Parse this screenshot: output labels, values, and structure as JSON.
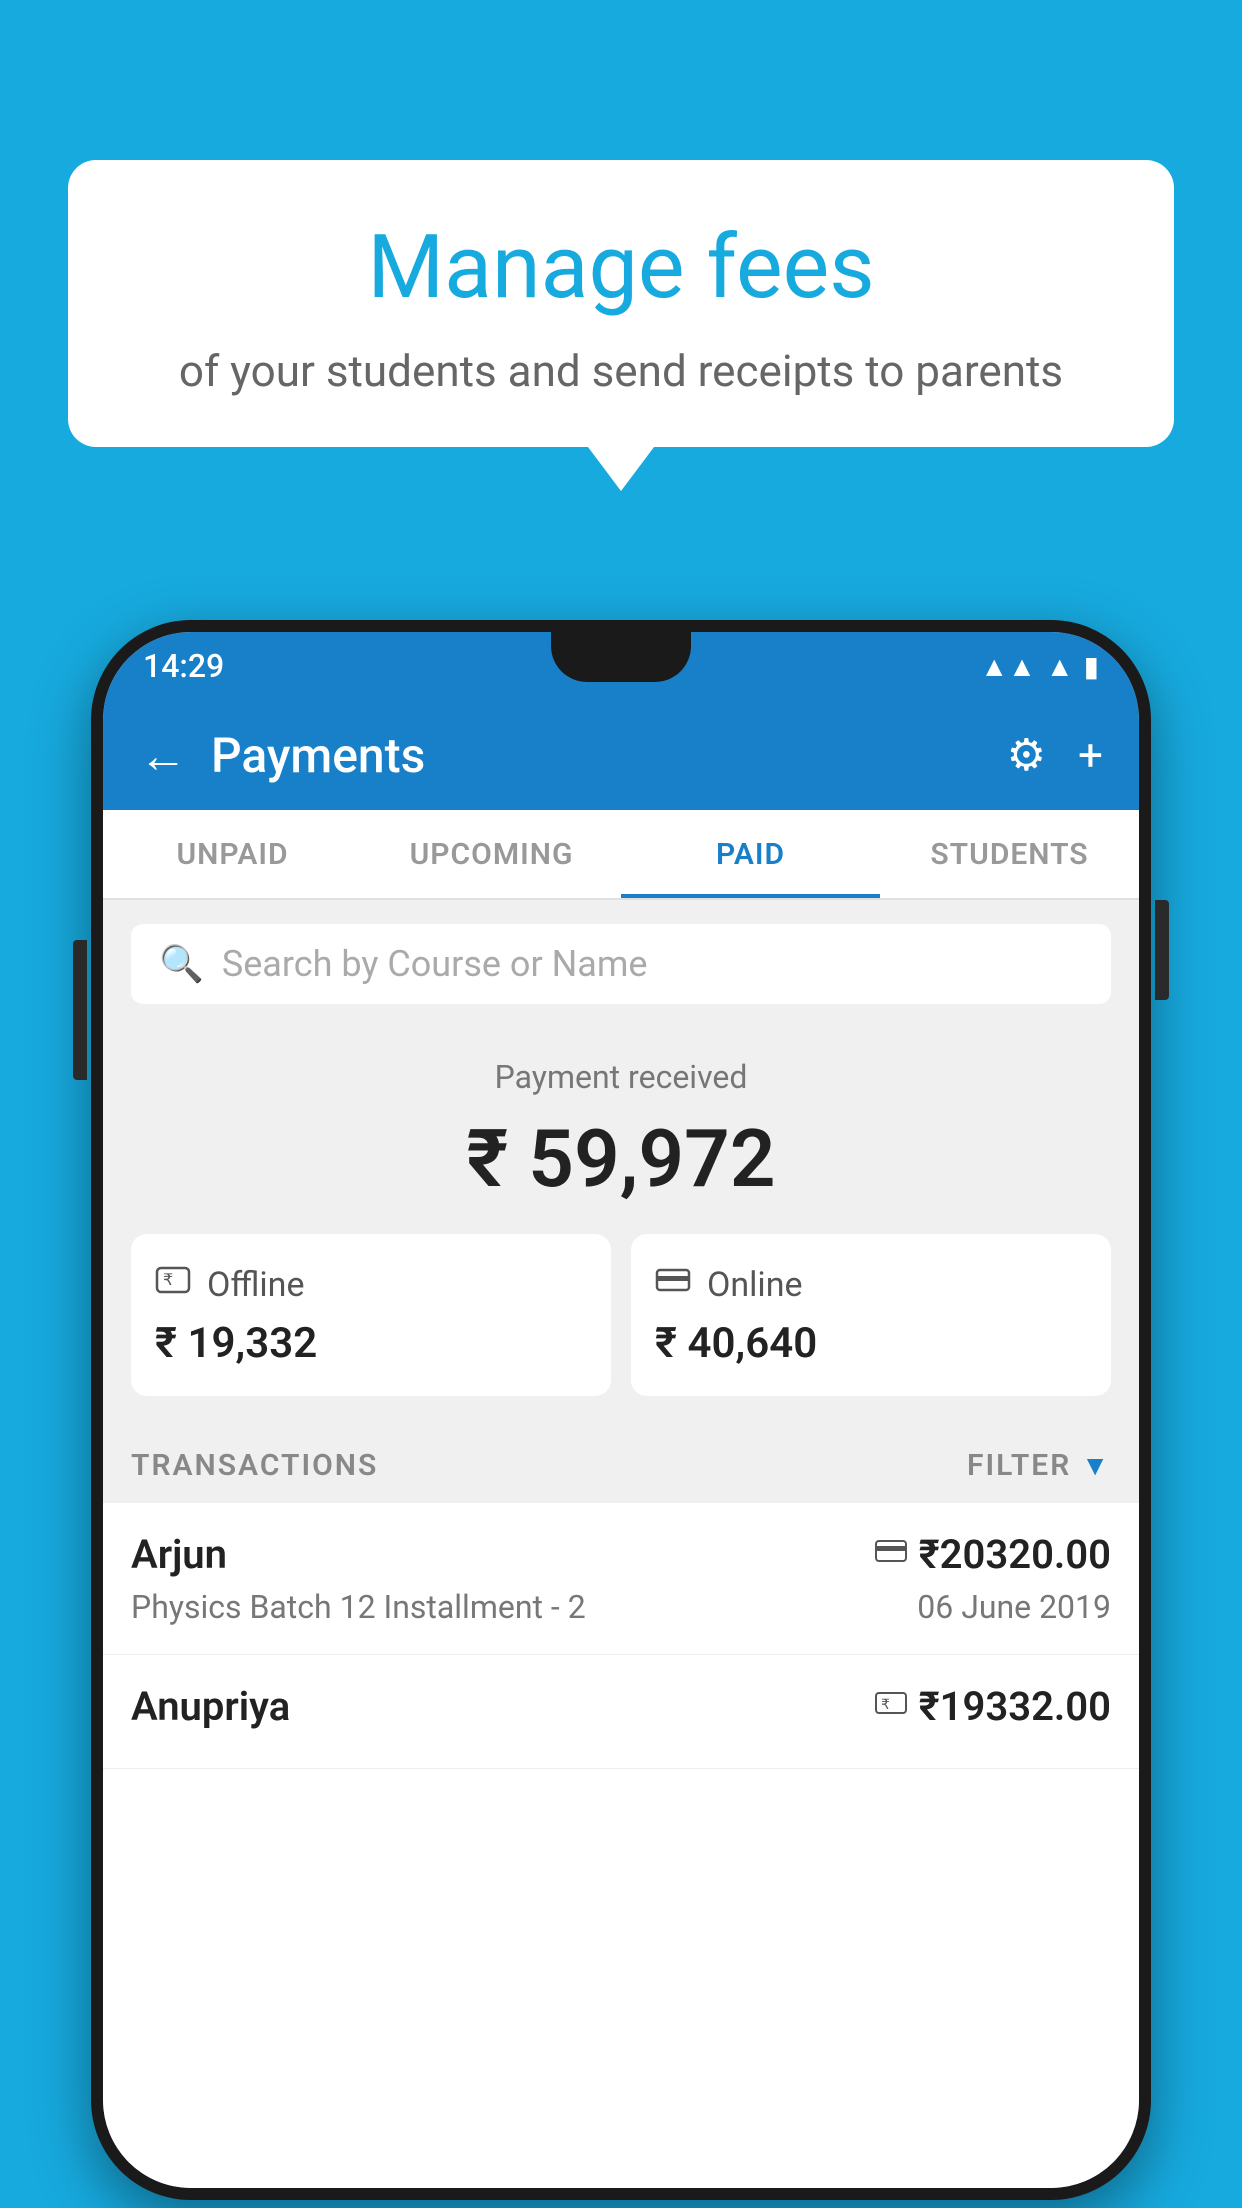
{
  "page": {
    "background_color": "#17AADF"
  },
  "speech_bubble": {
    "title": "Manage fees",
    "subtitle": "of your students and send receipts to parents"
  },
  "status_bar": {
    "time": "14:29",
    "wifi": "▲",
    "signal": "▲",
    "battery": "▪"
  },
  "app_bar": {
    "title": "Payments",
    "back_icon": "←",
    "gear_icon": "⚙",
    "plus_icon": "+"
  },
  "tabs": [
    {
      "label": "UNPAID",
      "active": false
    },
    {
      "label": "UPCOMING",
      "active": false
    },
    {
      "label": "PAID",
      "active": true
    },
    {
      "label": "STUDENTS",
      "active": false
    }
  ],
  "search": {
    "placeholder": "Search by Course or Name"
  },
  "payment_summary": {
    "label": "Payment received",
    "total": "₹ 59,972",
    "offline_label": "Offline",
    "offline_amount": "₹ 19,332",
    "online_label": "Online",
    "online_amount": "₹ 40,640"
  },
  "transactions": {
    "section_label": "TRANSACTIONS",
    "filter_label": "FILTER",
    "items": [
      {
        "name": "Arjun",
        "course": "Physics Batch 12 Installment - 2",
        "amount": "₹20320.00",
        "date": "06 June 2019",
        "type": "online"
      },
      {
        "name": "Anupriya",
        "course": "",
        "amount": "₹19332.00",
        "date": "",
        "type": "offline"
      }
    ]
  }
}
